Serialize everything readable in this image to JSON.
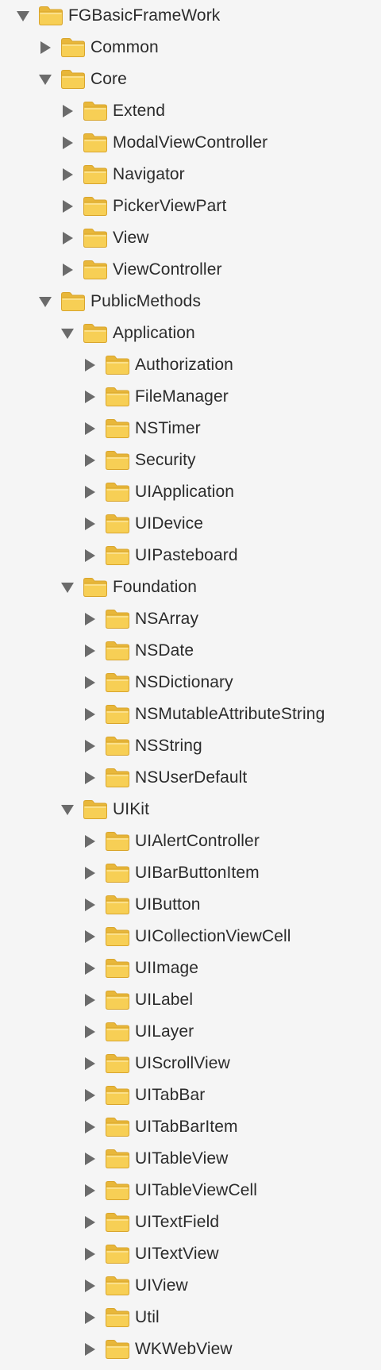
{
  "colors": {
    "background": "#f5f5f5",
    "folder_body": "#f7cf55",
    "folder_tab": "#e8b73a",
    "folder_edge": "#d9a52c",
    "disclosure": "#6b6b6b",
    "text": "#2b2b2b"
  },
  "icons": {
    "folder": "folder-icon",
    "expanded": "disclosure-triangle-down-icon",
    "collapsed": "disclosure-triangle-right-icon"
  },
  "tree": [
    {
      "label": "FGBasicFrameWork",
      "level": 0,
      "expanded": true
    },
    {
      "label": "Common",
      "level": 1,
      "expanded": false
    },
    {
      "label": "Core",
      "level": 1,
      "expanded": true
    },
    {
      "label": "Extend",
      "level": 2,
      "expanded": false
    },
    {
      "label": "ModalViewController",
      "level": 2,
      "expanded": false
    },
    {
      "label": "Navigator",
      "level": 2,
      "expanded": false
    },
    {
      "label": "PickerViewPart",
      "level": 2,
      "expanded": false
    },
    {
      "label": "View",
      "level": 2,
      "expanded": false
    },
    {
      "label": "ViewController",
      "level": 2,
      "expanded": false
    },
    {
      "label": "PublicMethods",
      "level": 1,
      "expanded": true
    },
    {
      "label": "Application",
      "level": 2,
      "expanded": true
    },
    {
      "label": "Authorization",
      "level": 3,
      "expanded": false
    },
    {
      "label": "FileManager",
      "level": 3,
      "expanded": false
    },
    {
      "label": "NSTimer",
      "level": 3,
      "expanded": false
    },
    {
      "label": "Security",
      "level": 3,
      "expanded": false
    },
    {
      "label": "UIApplication",
      "level": 3,
      "expanded": false
    },
    {
      "label": "UIDevice",
      "level": 3,
      "expanded": false
    },
    {
      "label": "UIPasteboard",
      "level": 3,
      "expanded": false
    },
    {
      "label": "Foundation",
      "level": 2,
      "expanded": true
    },
    {
      "label": "NSArray",
      "level": 3,
      "expanded": false
    },
    {
      "label": "NSDate",
      "level": 3,
      "expanded": false
    },
    {
      "label": "NSDictionary",
      "level": 3,
      "expanded": false
    },
    {
      "label": "NSMutableAttributeString",
      "level": 3,
      "expanded": false
    },
    {
      "label": "NSString",
      "level": 3,
      "expanded": false
    },
    {
      "label": "NSUserDefault",
      "level": 3,
      "expanded": false
    },
    {
      "label": "UIKit",
      "level": 2,
      "expanded": true
    },
    {
      "label": "UIAlertController",
      "level": 3,
      "expanded": false
    },
    {
      "label": "UIBarButtonItem",
      "level": 3,
      "expanded": false
    },
    {
      "label": "UIButton",
      "level": 3,
      "expanded": false
    },
    {
      "label": "UICollectionViewCell",
      "level": 3,
      "expanded": false
    },
    {
      "label": "UIImage",
      "level": 3,
      "expanded": false
    },
    {
      "label": "UILabel",
      "level": 3,
      "expanded": false
    },
    {
      "label": "UILayer",
      "level": 3,
      "expanded": false
    },
    {
      "label": "UIScrollView",
      "level": 3,
      "expanded": false
    },
    {
      "label": "UITabBar",
      "level": 3,
      "expanded": false
    },
    {
      "label": "UITabBarItem",
      "level": 3,
      "expanded": false
    },
    {
      "label": "UITableView",
      "level": 3,
      "expanded": false
    },
    {
      "label": "UITableViewCell",
      "level": 3,
      "expanded": false
    },
    {
      "label": "UITextField",
      "level": 3,
      "expanded": false
    },
    {
      "label": "UITextView",
      "level": 3,
      "expanded": false
    },
    {
      "label": "UIView",
      "level": 3,
      "expanded": false
    },
    {
      "label": "Util",
      "level": 3,
      "expanded": false
    },
    {
      "label": "WKWebView",
      "level": 3,
      "expanded": false
    }
  ]
}
